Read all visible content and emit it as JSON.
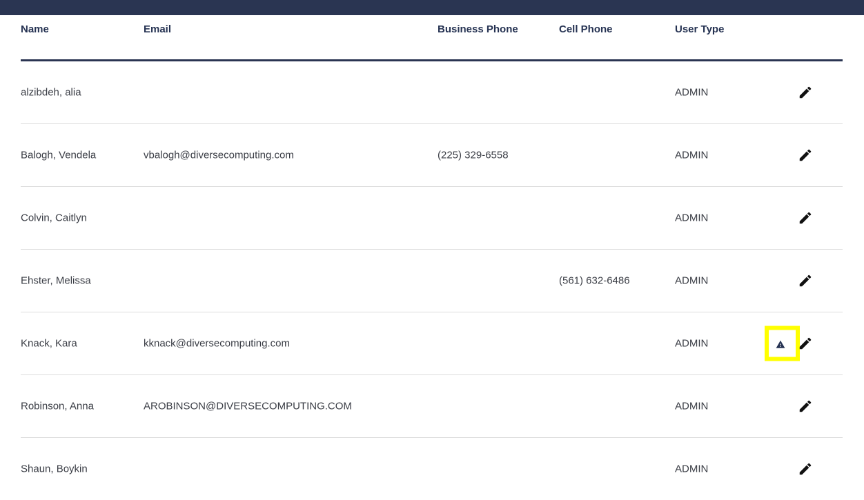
{
  "header": {
    "name": "Name",
    "email": "Email",
    "business_phone": "Business Phone",
    "cell_phone": "Cell Phone",
    "user_type": "User Type"
  },
  "rows": [
    {
      "name": "alzibdeh, alia",
      "email": "",
      "business_phone": "",
      "cell_phone": "",
      "user_type": "ADMIN",
      "warning": false
    },
    {
      "name": "Balogh, Vendela",
      "email": "vbalogh@diversecomputing.com",
      "business_phone": "(225) 329-6558",
      "cell_phone": "",
      "user_type": "ADMIN",
      "warning": false
    },
    {
      "name": "Colvin, Caitlyn",
      "email": "",
      "business_phone": "",
      "cell_phone": "",
      "user_type": "ADMIN",
      "warning": false
    },
    {
      "name": "Ehster, Melissa",
      "email": "",
      "business_phone": "",
      "cell_phone": "(561) 632-6486",
      "user_type": "ADMIN",
      "warning": false
    },
    {
      "name": "Knack, Kara",
      "email": "kknack@diversecomputing.com",
      "business_phone": "",
      "cell_phone": "",
      "user_type": "ADMIN",
      "warning": true
    },
    {
      "name": "Robinson, Anna",
      "email": "AROBINSON@DIVERSECOMPUTING.COM",
      "business_phone": "",
      "cell_phone": "",
      "user_type": "ADMIN",
      "warning": false
    },
    {
      "name": "Shaun, Boykin",
      "email": "",
      "business_phone": "",
      "cell_phone": "",
      "user_type": "ADMIN",
      "warning": false
    }
  ],
  "icons": {
    "edit": "pencil-icon",
    "warning": "warning-triangle-icon"
  },
  "colors": {
    "topbar": "#2a3552",
    "header_text": "#253252",
    "highlight": "#ffff00"
  }
}
